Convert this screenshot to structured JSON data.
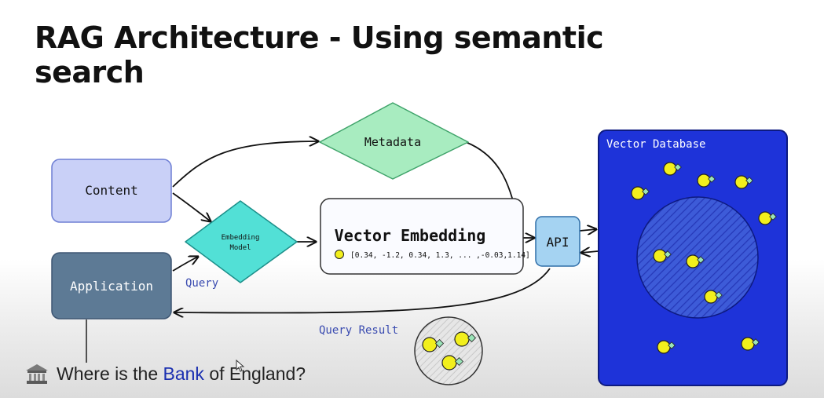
{
  "slide": {
    "title_line1": "RAG Architecture - Using semantic",
    "title_line2": "search"
  },
  "diagram": {
    "content_label": "Content",
    "application_label": "Application",
    "metadata_label": "Metadata",
    "embedding_model_line1": "Embedding",
    "embedding_model_line2": "Model",
    "vector_embedding_title": "Vector Embedding",
    "vector_embedding_values": "[0.34, -1.2, 0.34, 1.3, ... ,-0.03,1.14]",
    "api_label": "API",
    "vector_database_label": "Vector Database",
    "query_label": "Query",
    "query_result_label": "Query Result"
  },
  "caption": {
    "text_before": "Where is the",
    "highlight": "Bank",
    "text_after": "of England?",
    "icon": "bank-icon"
  },
  "colors": {
    "content_box": "#c9d0f7",
    "application_box": "#5d7a95",
    "metadata_diamond": "#a8ecc0",
    "embedding_diamond": "#52e0d6",
    "api_box": "#a5d3f2",
    "vector_db": "#1e33d9",
    "point": "#f2ef1c",
    "point_tag": "#9be4b8"
  }
}
